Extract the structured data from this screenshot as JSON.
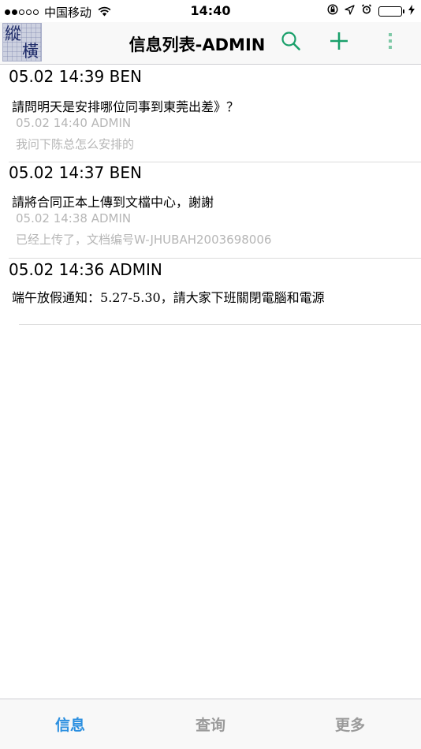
{
  "status_bar": {
    "carrier": "中国移动",
    "time": "14:40",
    "battery_level": 1.0,
    "signal_bars_filled": 2,
    "signal_bars_total": 5
  },
  "nav": {
    "logo_text_1": "縱",
    "logo_text_2": "橫",
    "title": "信息列表-ADMIN",
    "icons": [
      "search-icon",
      "add-icon",
      "more-icon"
    ],
    "accent_color": "#1aa06b"
  },
  "messages": [
    {
      "header": "05.02 14:39 BEN",
      "body": "請問明天是安排哪位同事到東莞出差》？",
      "reply_header": "05.02 14:40 ADMIN",
      "reply_body": "我问下陈总怎么安排的"
    },
    {
      "header": "05.02 14:37 BEN",
      "body": "請將合同正本上傳到文檔中心，謝謝",
      "reply_header": "05.02 14:38 ADMIN",
      "reply_body": "已经上传了，文档编号W-JHUBAH2003698006"
    },
    {
      "header": "05.02 14:36 ADMIN",
      "body_prefix": "端午放假通知：",
      "body_dates": "5.27-5.30",
      "body_suffix": "，請大家下班關閉電腦和電源"
    }
  ],
  "tabs": [
    {
      "label": "信息",
      "active": true
    },
    {
      "label": "查询",
      "active": false
    },
    {
      "label": "更多",
      "active": false
    }
  ],
  "colors": {
    "tab_active": "#2b8fe0",
    "tab_inactive": "#9a9a9a",
    "reply_text": "#b6b6b6"
  }
}
